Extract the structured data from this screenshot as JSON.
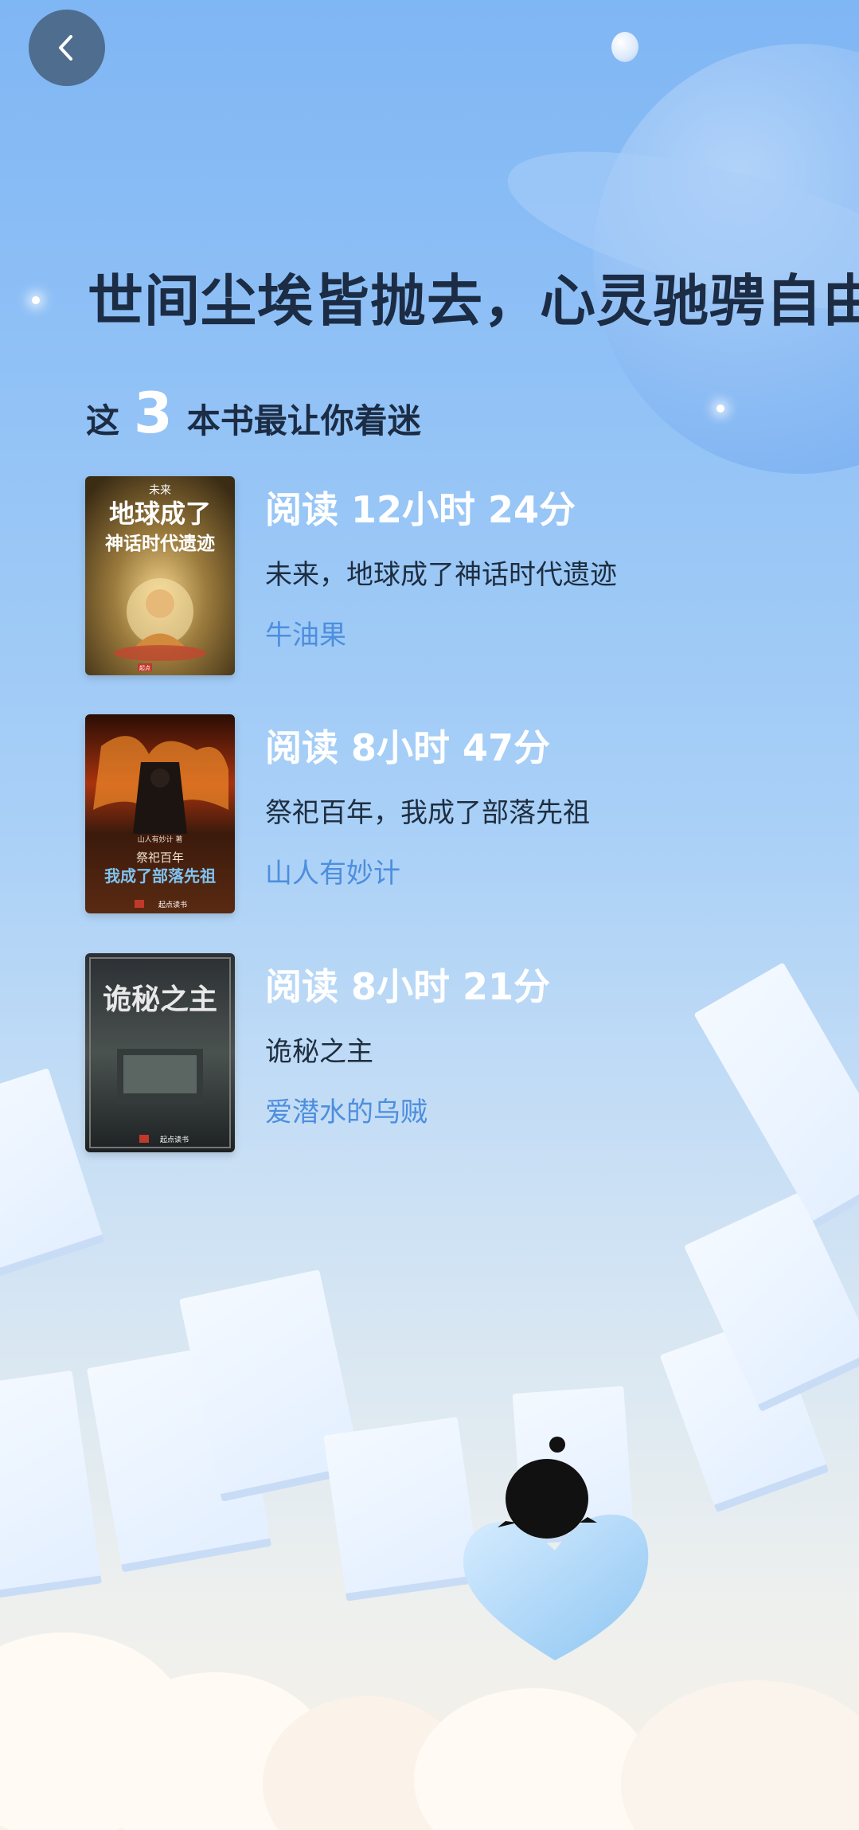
{
  "header": {
    "back_icon": "chevron-left-icon",
    "headline": "世间尘埃皆抛去，心灵驰骋自由间"
  },
  "summary": {
    "prefix": "这",
    "count": "3",
    "suffix": "本书最让你着迷"
  },
  "books": [
    {
      "reading_time": "阅读 12小时 24分",
      "title": "未来，地球成了神话时代遗迹",
      "author": "牛油果",
      "cover": {
        "top_label": "未来",
        "line1": "地球成了",
        "line2": "神话时代遗迹",
        "publisher_tag": "起点"
      }
    },
    {
      "reading_time": "阅读 8小时 47分",
      "title": "祭祀百年，我成了部落先祖",
      "author": "山人有妙计",
      "cover": {
        "author_small": "山人有妙计 著",
        "line1": "祭祀百年",
        "line2": "我成了部落先祖",
        "publisher_tag": "起点读书"
      }
    },
    {
      "reading_time": "阅读 8小时 21分",
      "title": "诡秘之主",
      "author": "爱潜水的乌贼",
      "cover": {
        "line1": "诡秘之主",
        "publisher_tag": "起点读书"
      }
    }
  ],
  "colors": {
    "accent_author": "#4d8ede",
    "headline": "#1b2c44",
    "back_button": "#4f6d8f"
  }
}
